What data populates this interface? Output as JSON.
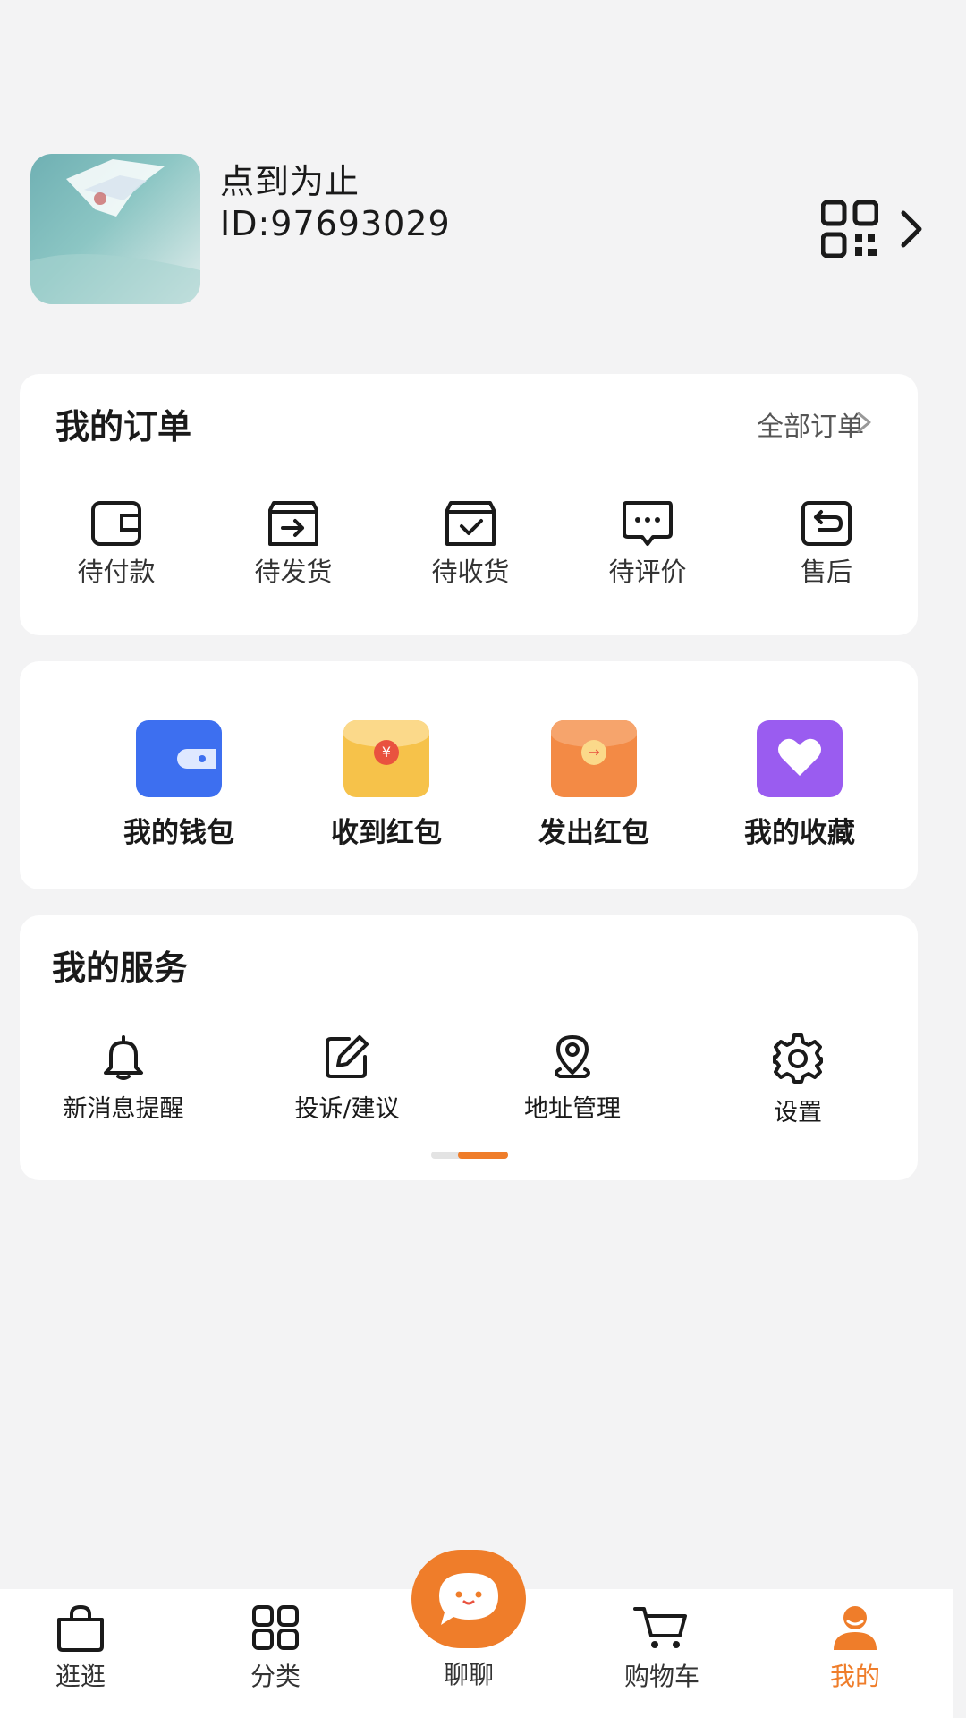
{
  "profile": {
    "nickname": "点到为止",
    "user_id": "ID:97693029",
    "qr_icon": "qr-code-icon",
    "arrow_icon": "chevron-right-icon"
  },
  "orders": {
    "title": "我的订单",
    "all_label": "全部订单",
    "items": [
      {
        "label": "待付款",
        "icon": "wallet-outline-icon"
      },
      {
        "label": "待发货",
        "icon": "box-arrow-icon"
      },
      {
        "label": "待收货",
        "icon": "box-check-icon"
      },
      {
        "label": "待评价",
        "icon": "comment-icon"
      },
      {
        "label": "售后",
        "icon": "return-icon"
      }
    ]
  },
  "wallet": {
    "items": [
      {
        "label": "我的钱包",
        "icon": "wallet-icon",
        "color": "#3d6ff0"
      },
      {
        "label": "收到红包",
        "icon": "red-envelope-received-icon",
        "color": "#f6c24a"
      },
      {
        "label": "发出红包",
        "icon": "red-envelope-sent-icon",
        "color": "#f38a45"
      },
      {
        "label": "我的收藏",
        "icon": "heart-icon",
        "color": "#9a5cf0"
      }
    ]
  },
  "services": {
    "title": "我的服务",
    "items": [
      {
        "label": "新消息提醒",
        "icon": "bell-icon"
      },
      {
        "label": "投诉/建议",
        "icon": "edit-icon"
      },
      {
        "label": "地址管理",
        "icon": "location-icon"
      },
      {
        "label": "设置",
        "icon": "gear-icon"
      }
    ]
  },
  "tabbar": {
    "accent": "#ef7d2a",
    "items": [
      {
        "label": "逛逛",
        "icon": "shopping-bag-icon",
        "active": false
      },
      {
        "label": "分类",
        "icon": "category-icon",
        "active": false
      },
      {
        "label": "聊聊",
        "icon": "chat-icon",
        "active": false
      },
      {
        "label": "购物车",
        "icon": "cart-icon",
        "active": false
      },
      {
        "label": "我的",
        "icon": "user-icon",
        "active": true
      }
    ]
  }
}
